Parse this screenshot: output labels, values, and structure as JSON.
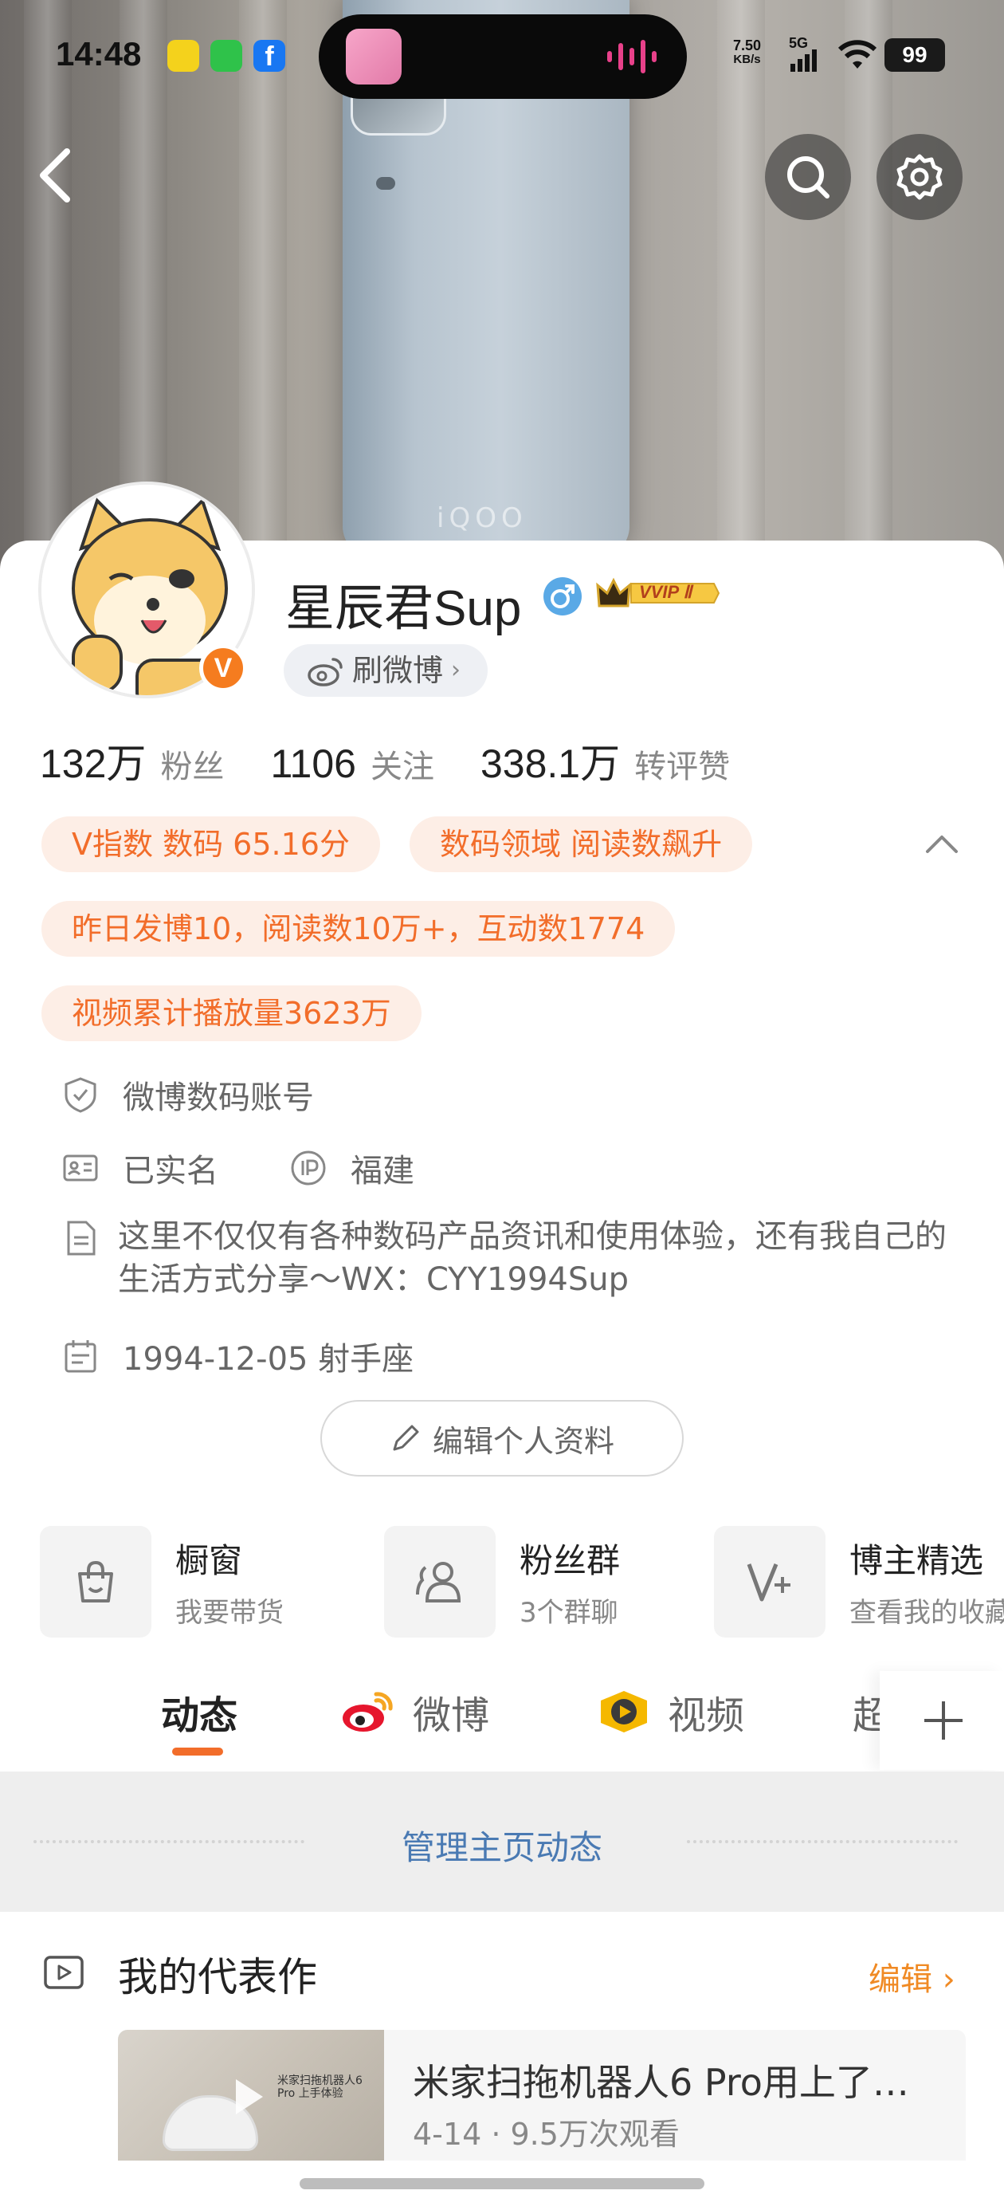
{
  "status_bar": {
    "time": "14:48",
    "net_speed_value": "7.50",
    "net_speed_unit": "KB/s",
    "network": "5G",
    "battery": "99"
  },
  "profile": {
    "name": "星辰君Sup",
    "vip_badge": "VVIP Ⅱ",
    "brush_label": "刷微博",
    "verified_badge": "V"
  },
  "stats": [
    {
      "value": "132万",
      "label": "粉丝"
    },
    {
      "value": "1106",
      "label": "关注"
    },
    {
      "value": "338.1万",
      "label": "转评赞"
    }
  ],
  "tags": {
    "v_index": "V指数 数码 65.16分",
    "domain": "数码领域 阅读数飙升",
    "yesterday": "昨日发博10，阅读数10万+，互动数1774",
    "video_plays": "视频累计播放量3623万"
  },
  "info": {
    "account_type": "微博数码账号",
    "real_name": "已实名",
    "ip_location": "福建",
    "bio": "这里不仅仅有各种数码产品资讯和使用体验，还有我自己的生活方式分享～WX：CYY1994Sup",
    "birthday": "1994-12-05 射手座"
  },
  "edit_profile": "编辑个人资料",
  "features": [
    {
      "title": "橱窗",
      "subtitle": "我要带货"
    },
    {
      "title": "粉丝群",
      "subtitle": "3个群聊"
    },
    {
      "title": "博主精选",
      "subtitle": "查看我的收藏"
    }
  ],
  "tabs": [
    "动态",
    "微博",
    "视频",
    "超"
  ],
  "manage_label": "管理主页动态",
  "representative": {
    "title": "我的代表作",
    "edit": "编辑",
    "video_title": "米家扫拖机器人6 Pro用上了…",
    "video_meta": "4-14 · 9.5万次观看",
    "thumb_caption": "米家扫拖机器人6 Pro 上手体验"
  },
  "colors": {
    "accent_orange": "#f26d2a",
    "tag_bg": "#fdeee6",
    "link_blue": "#4a7ab3",
    "verified_orange": "#f57c1f"
  },
  "hero_text": "iQOO"
}
